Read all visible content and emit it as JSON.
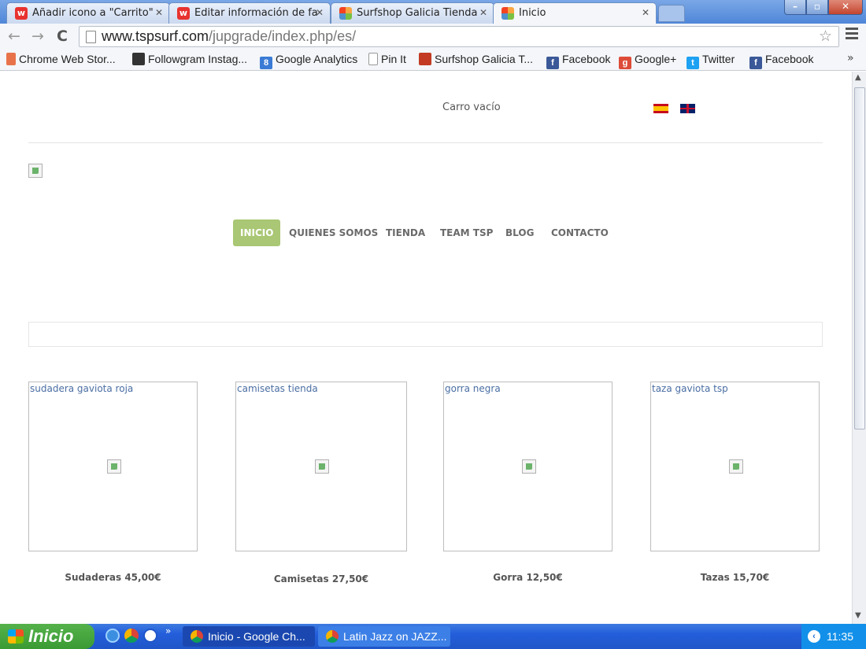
{
  "browser": {
    "tabs": [
      {
        "label": "Añadir icono a \"Carrito\"",
        "icon": "w-icon"
      },
      {
        "label": "Editar información de fa",
        "icon": "w-icon"
      },
      {
        "label": "Surfshop Galicia Tienda",
        "icon": "joomla-icon"
      },
      {
        "label": "Inicio",
        "icon": "joomla-icon"
      }
    ],
    "url_host": "www.tspsurf.com",
    "url_path": "/jupgrade/index.php/es/",
    "bookmarks": [
      {
        "label": "Chrome Web Stor...",
        "color": "#e8734a"
      },
      {
        "label": "Followgram Instag...",
        "color": "#333333"
      },
      {
        "label": "Google Analytics",
        "color": "#3a7bd5"
      },
      {
        "label": "Pin It",
        "color": "#ffffff"
      },
      {
        "label": "Surfshop Galicia T...",
        "color": "#c23b22"
      },
      {
        "label": "Facebook",
        "color": "#3b5998"
      },
      {
        "label": "Google+",
        "color": "#dd4b39"
      },
      {
        "label": "Twitter",
        "color": "#1da1f2"
      },
      {
        "label": "Facebook",
        "color": "#3b5998"
      }
    ],
    "bookmarks_more": "»"
  },
  "page": {
    "cart": "Carro vacío",
    "nav": [
      "INICIO",
      "QUIENES SOMOS",
      "TIENDA",
      "TEAM TSP",
      "BLOG",
      "CONTACTO"
    ],
    "nav_active_color": "#a9c774",
    "products": [
      {
        "caption": "sudadera gaviota roja",
        "label": "Sudaderas 45,00€"
      },
      {
        "caption": "camisetas tienda",
        "label": "Camisetas 27,50€"
      },
      {
        "caption": "gorra negra",
        "label": "Gorra 12,50€"
      },
      {
        "caption": "taza gaviota tsp",
        "label": "Tazas 15,70€"
      }
    ]
  },
  "taskbar": {
    "start": "Inicio",
    "tasks": [
      "Inicio - Google Ch...",
      "Latin Jazz on JAZZ..."
    ],
    "quicklaunch_more": "»",
    "clock": "11:35"
  }
}
